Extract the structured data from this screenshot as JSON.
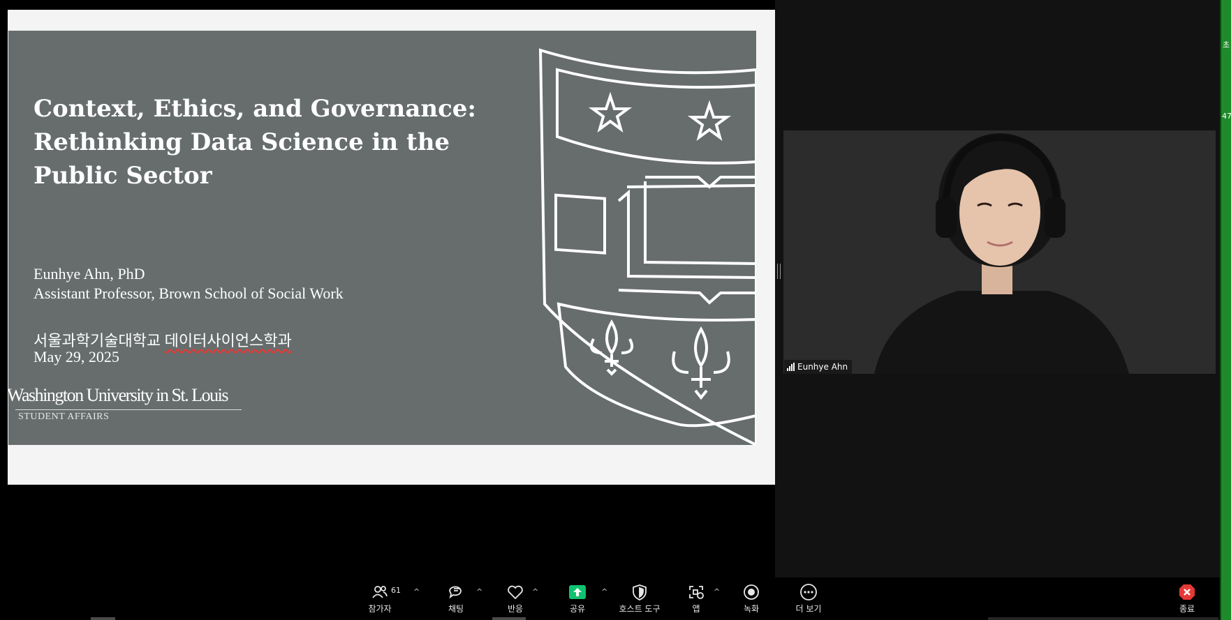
{
  "slide": {
    "title": "Context, Ethics, and Governance: Rethinking Data Science in the Public Sector",
    "presenter": "Eunhye Ahn, PhD",
    "position": "Assistant Professor, Brown School of Social Work",
    "host_org_part1": "서울과학기술대학교",
    "host_org_part2": "데이터사이언스학과",
    "date": "May 29, 2025",
    "logo_text": "Washington University in St. Louis",
    "logo_subtext": "STUDENT AFFAIRS"
  },
  "video": {
    "participant_name": "Eunhye Ahn"
  },
  "edge": {
    "top_text": "초",
    "mid_text": "47"
  },
  "toolbar": {
    "participants_label": "참가자",
    "participants_count": "61",
    "chat_label": "채팅",
    "reactions_label": "반응",
    "share_label": "공유",
    "host_tools_label": "호스트 도구",
    "apps_label": "앱",
    "record_label": "녹화",
    "more_label": "더 보기",
    "end_label": "종료",
    "caret": "^"
  },
  "colors": {
    "slide_bg": "#676d6d",
    "share_green": "#10c26f",
    "end_red": "#e53935",
    "edge_green": "#1f8a2a"
  }
}
